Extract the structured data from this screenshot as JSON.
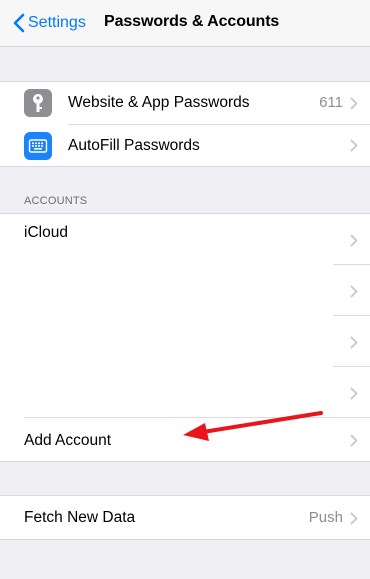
{
  "navbar": {
    "back_label": "Settings",
    "title": "Passwords & Accounts"
  },
  "passwords_group": {
    "items": [
      {
        "label": "Website & App Passwords",
        "value": "611",
        "icon": "key-icon",
        "icon_color": "#8e8e93"
      },
      {
        "label": "AutoFill Passwords",
        "value": "",
        "icon": "keyboard-icon",
        "icon_color": "#1a82fb"
      }
    ]
  },
  "accounts_section": {
    "header": "ACCOUNTS",
    "items": [
      {
        "label": "iCloud"
      },
      {
        "label": ""
      },
      {
        "label": ""
      },
      {
        "label": ""
      },
      {
        "label": ""
      }
    ],
    "add_account_label": "Add Account"
  },
  "fetch_group": {
    "label": "Fetch New Data",
    "value": "Push"
  },
  "annotation": {
    "type": "arrow",
    "color": "#e8151b",
    "points_to": "Add Account"
  },
  "colors": {
    "accent": "#007aff",
    "background": "#efeff4",
    "chevron": "#c7c7cc"
  }
}
